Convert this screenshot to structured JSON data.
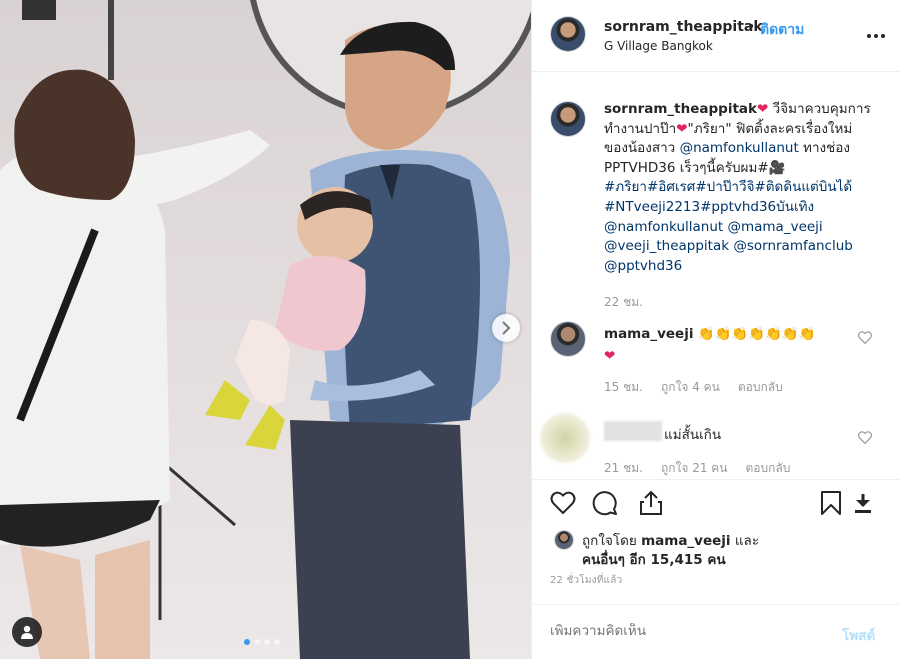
{
  "header": {
    "username": "sornram_theappitak",
    "separator": "•",
    "follow_label": "ติดตาม",
    "location": "G Village Bangkok"
  },
  "caption": {
    "username": "sornram_theappitak",
    "part1": " วีจิมาควบคุมการทำงานปาป๊า",
    "part2": "\"ภริยา\" ฟิตติ้งละครเรื่องใหม่ของน้องสาว ",
    "mention1": "@namfonkullanut",
    "part3": " ทางช่อง PPTVHD36 เร็วๆนี้ครับผม#",
    "tags": "#ภริยา#อิศเรศ#ปาป๊าวีจิ#ติดดินแต่บินได้ #NTveeji2213#pptvhd36บันเทิง",
    "mentions_tail": " @namfonkullanut @mama_veeji @veeji_theappitak @sornramfanclub @pptvhd36",
    "time": "22 ชม."
  },
  "comments": [
    {
      "username": "mama_veeji",
      "text": "👏👏👏👏👏👏👏",
      "time": "15 ชม.",
      "likes": "ถูกใจ 4 คน",
      "reply": "ตอบกลับ"
    },
    {
      "text": "แม่สั้นเกิน",
      "time": "21 ชม.",
      "likes": "ถูกใจ 21 คน",
      "reply": "ตอบกลับ"
    }
  ],
  "likes": {
    "prefix": "ถูกใจโดย ",
    "user": "mama_veeji",
    "and": " และ",
    "others": "คนอื่นๆ อีก 15,415 คน"
  },
  "timestamp": "22 ชั่วโมงที่แล้ว",
  "add_comment": {
    "placeholder": "เพิ่มความคิดเห็น",
    "post_label": "โพสต์"
  },
  "icons": {
    "heart": "heart-icon",
    "comment": "comment-icon",
    "share": "share-icon",
    "save": "bookmark-icon",
    "download": "download-icon",
    "next": "chevron-right-icon",
    "tag": "user-tag-icon"
  },
  "colors": {
    "link": "#3897f0",
    "mention": "#003569",
    "heart": "#e0245e",
    "post_disabled": "#b2dffc"
  }
}
